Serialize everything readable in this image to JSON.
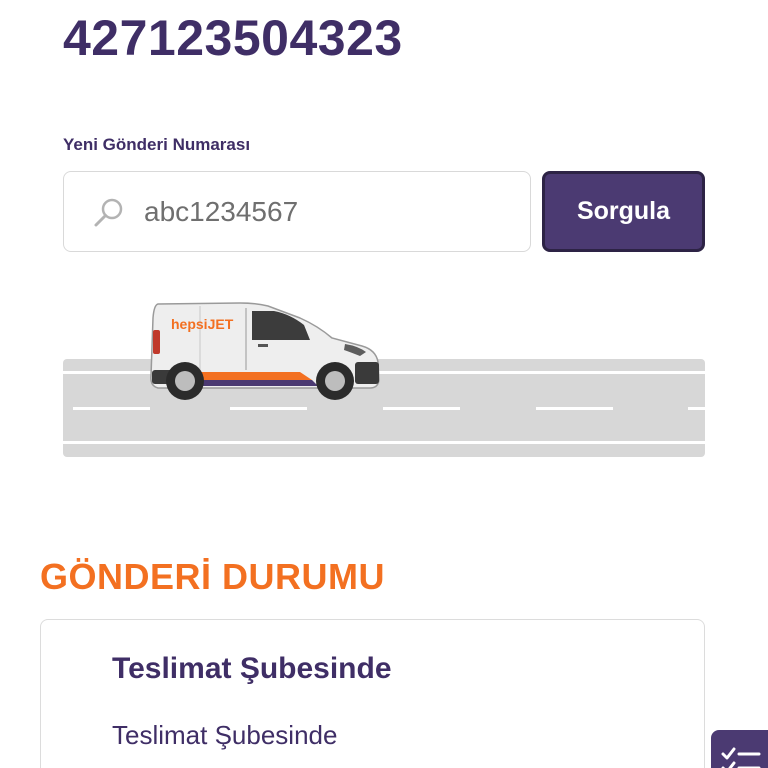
{
  "header": {
    "tracking_number": "427123504323"
  },
  "search": {
    "label": "Yeni Gönderi Numarası",
    "value": "abc1234567",
    "button_label": "Sorgula"
  },
  "van": {
    "brand": "hepsiJET"
  },
  "status_section": {
    "title": "GÖNDERİ DURUMU",
    "current_status": "Teslimat Şubesinde",
    "description": "Teslimat Şubesinde"
  },
  "colors": {
    "primary": "#4b3a72",
    "heading": "#3f2e66",
    "accent": "#f37021",
    "road": "#d7d7d7"
  },
  "icons": {
    "search": "search-icon",
    "fab": "checklist-icon"
  }
}
